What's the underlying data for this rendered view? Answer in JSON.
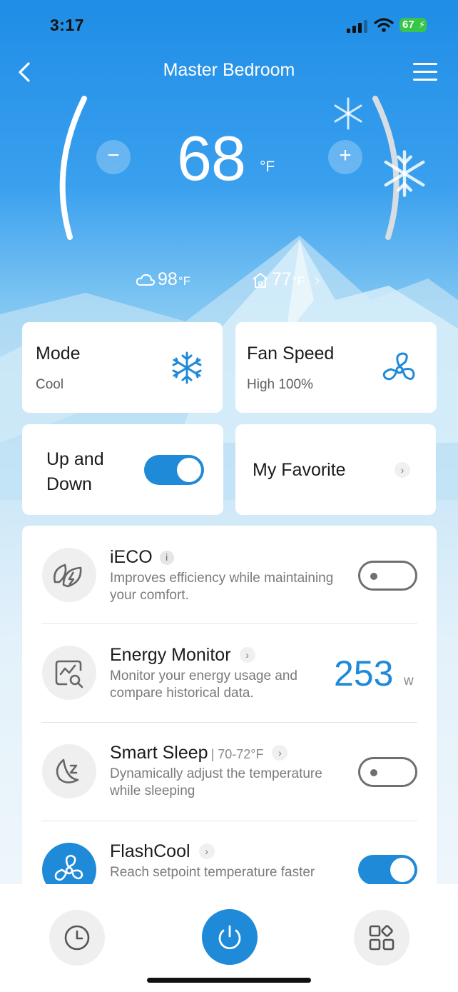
{
  "status_bar": {
    "time": "3:17",
    "battery": "67"
  },
  "header": {
    "title": "Master Bedroom",
    "back_icon": "chevron-left-icon",
    "menu_icon": "menu-icon"
  },
  "thermostat": {
    "setpoint": "68",
    "unit": "°F",
    "decrease_label": "−",
    "increase_label": "+",
    "outdoor_temp": "98",
    "outdoor_unit": "°F",
    "indoor_temp": "77",
    "indoor_unit": "°F",
    "indoor_chevron": "›"
  },
  "cards": {
    "mode": {
      "title": "Mode",
      "value": "Cool",
      "icon": "snowflake-icon"
    },
    "fan_speed": {
      "title": "Fan Speed",
      "value": "High 100%",
      "icon": "fan-icon"
    },
    "up_down": {
      "title_line1": "Up and",
      "title_line2": "Down",
      "enabled": true
    },
    "favorite": {
      "title": "My Favorite",
      "chevron": "›"
    }
  },
  "features": [
    {
      "title": "iECO",
      "badge": "i",
      "desc": "Improves efficiency while maintaining your comfort.",
      "enabled": false,
      "icon": "leaf-icon"
    },
    {
      "title": "Energy Monitor",
      "chevron": "›",
      "desc": "Monitor your energy usage and compare historical data.",
      "value": "253",
      "unit": "w",
      "icon": "energy-monitor-icon"
    },
    {
      "title": "Smart Sleep",
      "range": "| 70-72°F",
      "chevron": "›",
      "desc": "Dynamically adjust the temperature while sleeping",
      "enabled": false,
      "icon": "moon-icon"
    },
    {
      "title": "FlashCool",
      "chevron": "›",
      "desc": "Reach setpoint temperature faster",
      "enabled": true,
      "icon": "flashcool-icon"
    }
  ],
  "bottom_nav": {
    "schedule_icon": "clock-icon",
    "power_icon": "power-icon",
    "more_icon": "apps-grid-icon"
  },
  "colors": {
    "accent": "#1f8ad8",
    "sky_top": "#1f8de6",
    "battery": "#39c44c"
  }
}
